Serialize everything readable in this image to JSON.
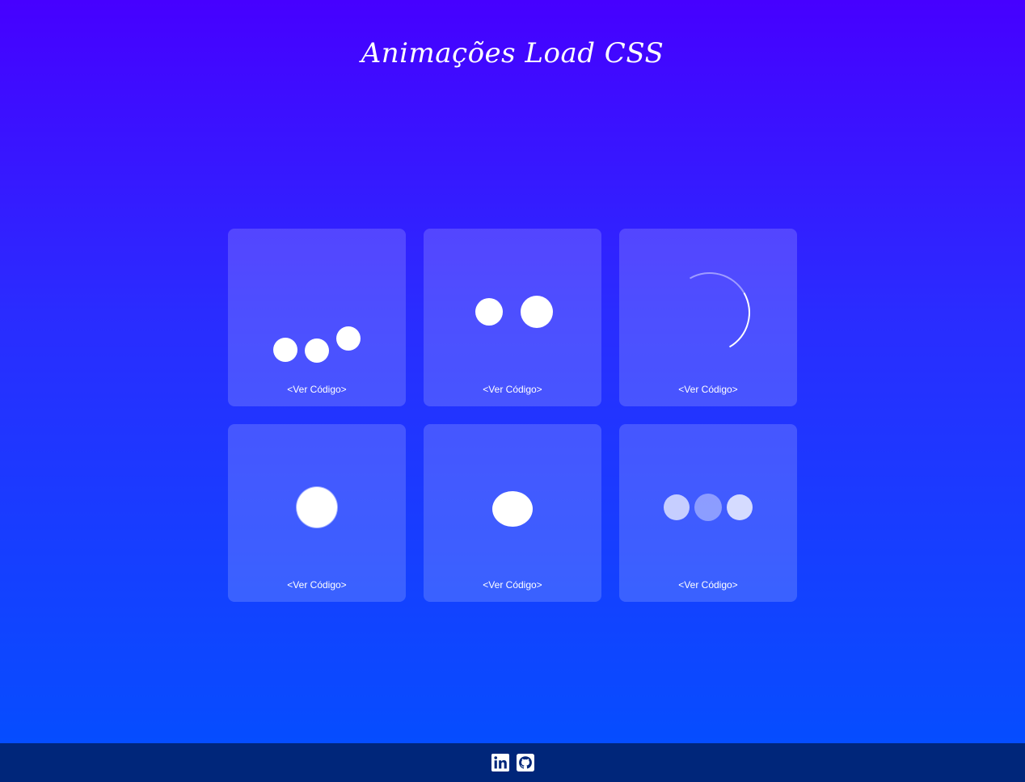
{
  "header": {
    "title": "Animações Load CSS"
  },
  "cards": [
    {
      "animation": "bouncing-dots",
      "link_label": "<Ver Código>"
    },
    {
      "animation": "two-dots",
      "link_label": "<Ver Código>"
    },
    {
      "animation": "spinner-arc",
      "link_label": "<Ver Código>"
    },
    {
      "animation": "pulse-circle",
      "link_label": "<Ver Código>"
    },
    {
      "animation": "morph-ellipse",
      "link_label": "<Ver Código>"
    },
    {
      "animation": "fading-dots",
      "link_label": "<Ver Código>"
    }
  ],
  "footer": {
    "icons": [
      {
        "icon": "linkedin-icon"
      },
      {
        "icon": "github-icon"
      }
    ]
  },
  "colors": {
    "background_top": "#4600ff",
    "background_bottom": "#0050ff",
    "footer": "#00267a",
    "card": "rgba(255,255,255,0.17)",
    "text": "#ffffff"
  }
}
